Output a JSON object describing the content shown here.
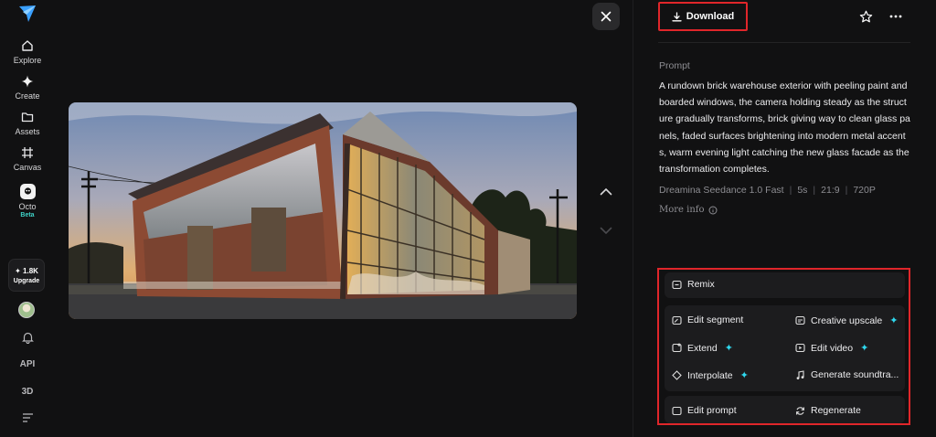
{
  "sidebar": {
    "items": [
      {
        "label": "Explore",
        "icon": "home-icon"
      },
      {
        "label": "Create",
        "icon": "sparkle-icon"
      },
      {
        "label": "Assets",
        "icon": "folder-icon"
      },
      {
        "label": "Canvas",
        "icon": "canvas-icon"
      },
      {
        "label": "Octo",
        "icon": "octo-icon",
        "badge": "Beta"
      }
    ],
    "credits": "1.8K",
    "upgrade_label": "Upgrade",
    "api_label": "API",
    "threed_label": "3D"
  },
  "toolbar": {
    "download_label": "Download"
  },
  "prompt": {
    "label": "Prompt",
    "text": "A rundown brick warehouse exterior with peeling paint and boarded windows, the camera holding steady as the structure gradually transforms, brick giving way to clean glass panels, faded surfaces brightening into modern metal accents, warm evening light catching the new glass facade as the transformation completes.",
    "model": "Dreamina Seedance 1.0 Fast",
    "duration": "5s",
    "ratio": "21:9",
    "resolution": "720P",
    "more_info_label": "More info"
  },
  "actions": {
    "remix": "Remix",
    "edit_segment": "Edit segment",
    "creative_upscale": "Creative upscale",
    "extend": "Extend",
    "edit_video": "Edit video",
    "interpolate": "Interpolate",
    "generate_soundtrack": "Generate soundtra...",
    "edit_prompt": "Edit prompt",
    "regenerate": "Regenerate"
  },
  "colors": {
    "highlight": "#e0262a",
    "accent": "#2fd8ee",
    "background": "#111112"
  }
}
